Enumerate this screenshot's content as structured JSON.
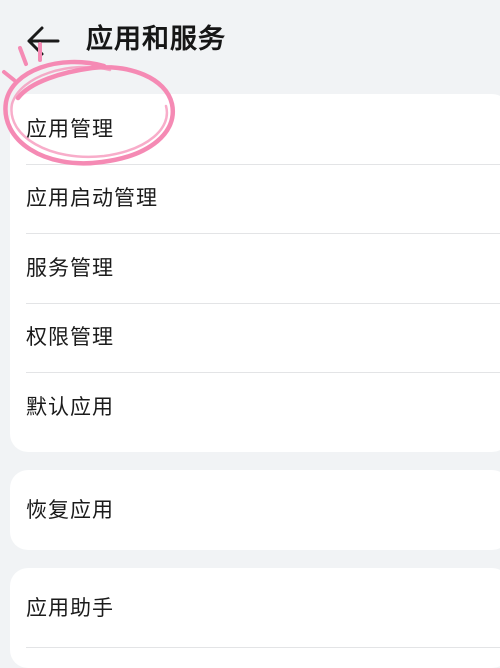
{
  "header": {
    "back_icon": "arrow-left-icon",
    "title": "应用和服务"
  },
  "groups": [
    {
      "items": [
        {
          "label": "应用管理",
          "highlighted": true
        },
        {
          "label": "应用启动管理"
        },
        {
          "label": "服务管理"
        },
        {
          "label": "权限管理"
        },
        {
          "label": "默认应用"
        }
      ]
    },
    {
      "items": [
        {
          "label": "恢复应用"
        }
      ]
    },
    {
      "items": [
        {
          "label": "应用助手"
        }
      ]
    }
  ],
  "colors": {
    "background": "#f1f3f5",
    "card": "#ffffff",
    "annotation_pink": "#f58ab4"
  }
}
